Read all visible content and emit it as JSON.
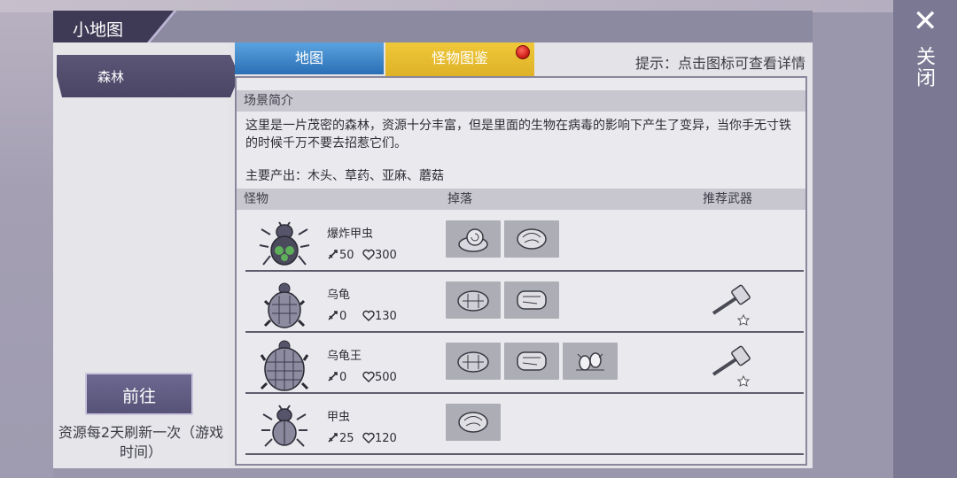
{
  "window": {
    "title": "小地图",
    "close_label": "关闭"
  },
  "sidebar": {
    "areas": [
      {
        "label": "森林",
        "selected": true
      }
    ],
    "go_label": "前往",
    "refresh_note": "资源每2天刷新一次（游戏时间）"
  },
  "tabs": [
    {
      "label": "地图",
      "active": false,
      "color": "#2a6fb5"
    },
    {
      "label": "怪物图鉴",
      "active": true,
      "color": "#d8a81e",
      "has_notification": true
    }
  ],
  "hint": "提示：点击图标可查看详情",
  "scene": {
    "section_title": "场景简介",
    "description": "这里是一片茂密的森林，资源十分丰富，但是里面的生物在病毒的影响下产生了变异，当你手无寸铁的时候千万不要去招惹它们。",
    "products": "主要产出：木头、草药、亚麻、蘑菇"
  },
  "table": {
    "headers": {
      "monster": "怪物",
      "drop": "掉落",
      "weapon": "推荐武器"
    },
    "rows": [
      {
        "name": "爆炸甲虫",
        "attack": "50",
        "hp": "300",
        "icon": "beetle-icon",
        "drops": [
          "snail-shell-icon",
          "meat-icon"
        ],
        "weapon": null
      },
      {
        "name": "乌龟",
        "attack": "0",
        "hp": "130",
        "icon": "turtle-icon",
        "drops": [
          "turtle-shell-icon",
          "steak-icon"
        ],
        "weapon": "hammer-icon"
      },
      {
        "name": "乌龟王",
        "attack": "0",
        "hp": "500",
        "icon": "turtle-king-icon",
        "drops": [
          "turtle-shell-icon",
          "steak-icon",
          "eggs-icon"
        ],
        "weapon": "hammer-icon"
      },
      {
        "name": "甲虫",
        "attack": "25",
        "hp": "120",
        "icon": "beetle-icon",
        "drops": [
          "meat-icon"
        ],
        "weapon": null
      }
    ]
  },
  "colors": {
    "title_bar": "#3e3a55",
    "tab_map": "#2a6fb5",
    "tab_monster": "#d8a81e",
    "notification": "#d0211b",
    "button": "#575277"
  }
}
